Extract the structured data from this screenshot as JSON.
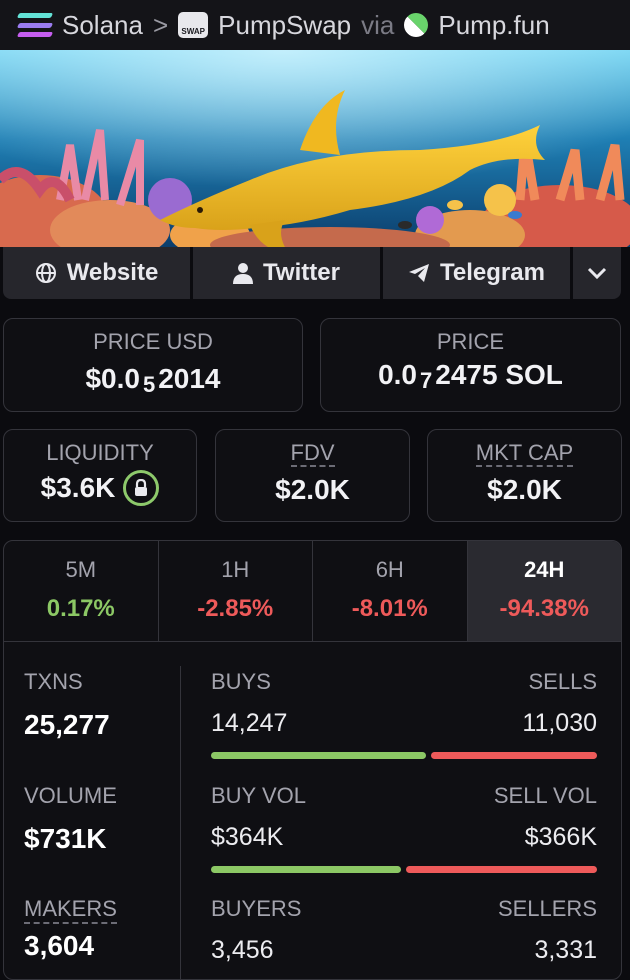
{
  "breadcrumb": {
    "chain": "Solana",
    "sep": ">",
    "dex": "PumpSwap",
    "via": "via",
    "launchpad": "Pump.fun"
  },
  "links": {
    "website": "Website",
    "twitter": "Twitter",
    "telegram": "Telegram"
  },
  "price": {
    "usd_label": "PRICE USD",
    "usd_prefix": "$0.0",
    "usd_sub": "5",
    "usd_digits": "2014",
    "native_label": "PRICE",
    "native_prefix": "0.0",
    "native_sub": "7",
    "native_digits": "2475 SOL"
  },
  "metrics": {
    "liquidity_label": "LIQUIDITY",
    "liquidity": "$3.6K",
    "fdv_label": "FDV",
    "fdv": "$2.0K",
    "mcap_label": "MKT CAP",
    "mcap": "$2.0K"
  },
  "changes": [
    {
      "label": "5M",
      "value": "0.17%"
    },
    {
      "label": "1H",
      "value": "-2.85%"
    },
    {
      "label": "6H",
      "value": "-8.01%"
    },
    {
      "label": "24H",
      "value": "-94.38%"
    }
  ],
  "txns": {
    "label": "TXNS",
    "value": "25,277",
    "buys_label": "BUYS",
    "buys": "14,247",
    "sells_label": "SELLS",
    "sells": "11,030",
    "buy_ratio": 0.564
  },
  "volume": {
    "label": "VOLUME",
    "value": "$731K",
    "buy_label": "BUY VOL",
    "buy": "$364K",
    "sell_label": "SELL VOL",
    "sell": "$366K",
    "buy_ratio": 0.499
  },
  "makers": {
    "label": "MAKERS",
    "value": "3,604",
    "buyers_label": "BUYERS",
    "buyers": "3,456",
    "sellers_label": "SELLERS",
    "sellers": "3,331"
  },
  "colors": {
    "positive": "#8cc865",
    "negative": "#ee5a5a",
    "lock_ring": "#8dc96b"
  }
}
